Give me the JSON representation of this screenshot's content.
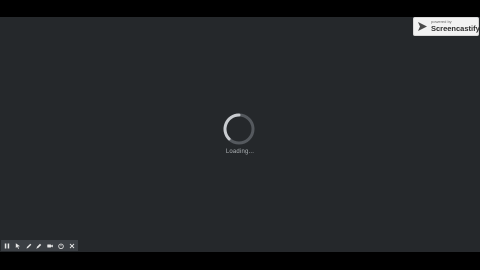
{
  "loader": {
    "text": "Loading..."
  },
  "watermark": {
    "sub_text": "powered by",
    "brand": "Screencastify"
  },
  "toolbar": {
    "buttons": [
      {
        "icon": "pause-icon"
      },
      {
        "icon": "cursor-icon"
      },
      {
        "icon": "pen-icon"
      },
      {
        "icon": "highlighter-icon"
      },
      {
        "icon": "camera-icon"
      },
      {
        "icon": "timer-icon"
      },
      {
        "icon": "close-icon"
      }
    ]
  },
  "colors": {
    "background": "#25282b",
    "spinner_track": "#55595e",
    "spinner_arc": "#c9ccd0",
    "toolbar": "#3b3f44"
  }
}
